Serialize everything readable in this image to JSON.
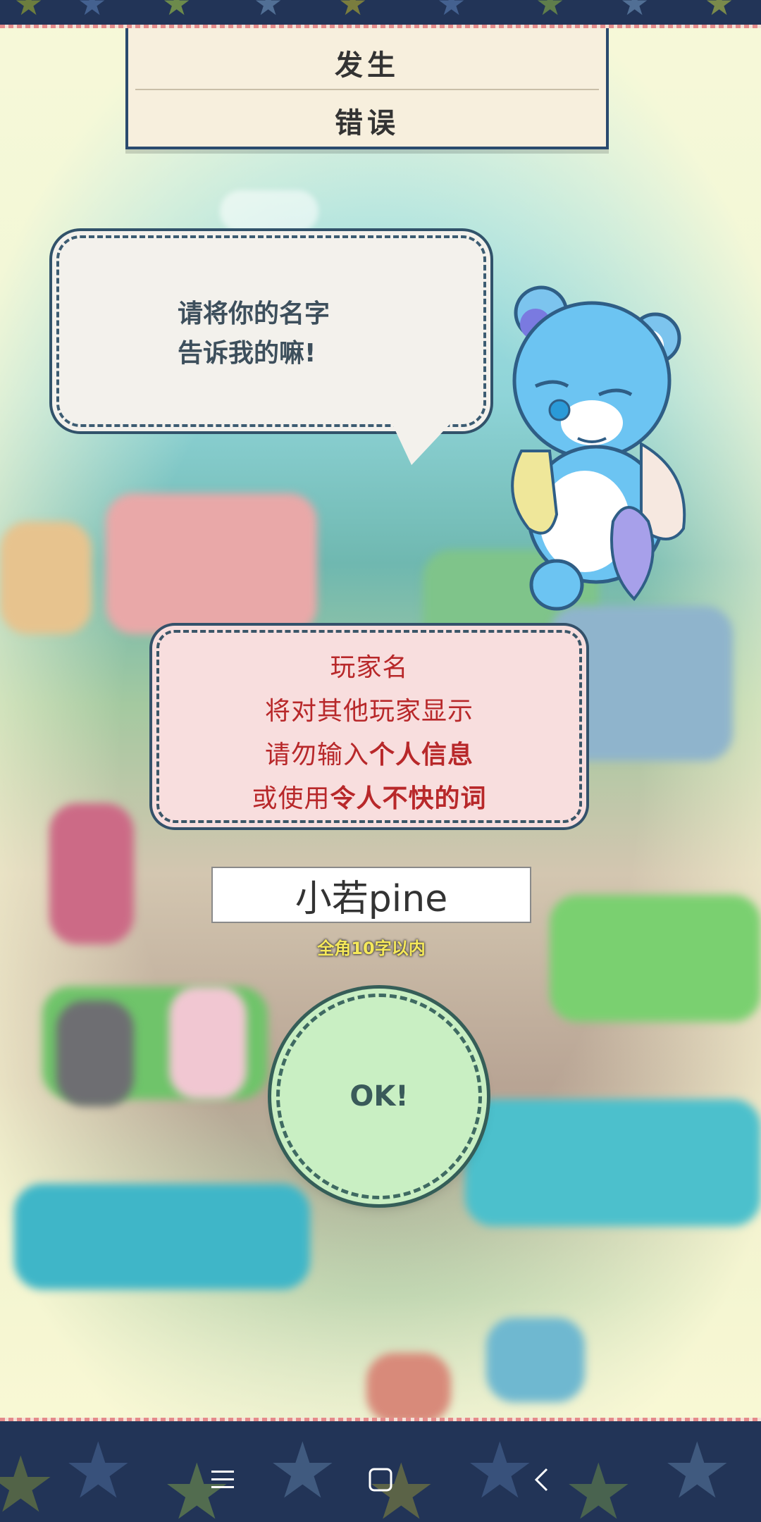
{
  "header": {
    "title_line1": "发生",
    "title_line2": "错误"
  },
  "dialog": {
    "line1": "请将你的名字",
    "line2": "告诉我的嘛!"
  },
  "notice": {
    "line1": "玩家名",
    "line2": "将对其他玩家显示",
    "line3_normal": "请勿输入",
    "line3_bold": "个人信息",
    "line4_normal": "或使用",
    "line4_bold": "令人不快的词"
  },
  "name_input": {
    "value": "小若pine"
  },
  "hint": "全角10字以内",
  "ok_button": {
    "label": "OK!"
  },
  "navbar": {
    "menu_icon": "menu-icon",
    "home_icon": "home-square-icon",
    "back_icon": "back-chevron-icon"
  },
  "colors": {
    "notice_text": "#b8282a",
    "band": "#223457",
    "ok_fill": "#c9efc3"
  }
}
